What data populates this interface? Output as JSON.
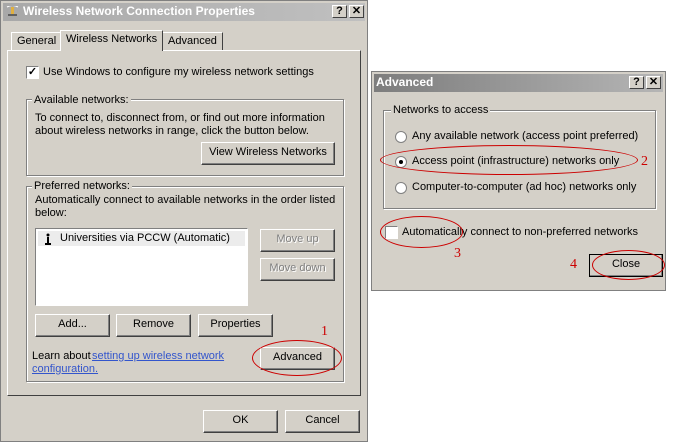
{
  "main_dialog": {
    "title": "Wireless Network Connection Properties",
    "help_button": "?",
    "close_button": "✕",
    "tabs": [
      {
        "label": "General"
      },
      {
        "label": "Wireless Networks"
      },
      {
        "label": "Advanced"
      }
    ],
    "use_windows_checkbox": {
      "label": "Use Windows to configure my wireless network settings",
      "checked": true
    },
    "available_networks": {
      "group_label": "Available networks:",
      "description_line1": "To connect to, disconnect from, or find out more information",
      "description_line2": "about wireless networks in range, click the button below.",
      "view_button": "View Wireless Networks"
    },
    "preferred_networks": {
      "group_label": "Preferred networks:",
      "description_line1": "Automatically connect to available networks in the order listed",
      "description_line2": "below:",
      "items": [
        {
          "label": "Universities via PCCW (Automatic)"
        }
      ],
      "move_up_button": "Move up",
      "move_down_button": "Move down",
      "add_button": "Add...",
      "remove_button": "Remove",
      "properties_button": "Properties",
      "learn_about_text": "Learn about",
      "learn_link_line1": "setting up wireless network",
      "learn_link_line2": "configuration.",
      "advanced_button": "Advanced"
    },
    "ok_button": "OK",
    "cancel_button": "Cancel"
  },
  "advanced_dialog": {
    "title": "Advanced",
    "help_button": "?",
    "close_button": "✕",
    "group_label": "Networks to access",
    "options": [
      {
        "label": "Any available network (access point preferred)",
        "selected": false
      },
      {
        "label": "Access point (infrastructure) networks only",
        "selected": true
      },
      {
        "label": "Computer-to-computer (ad hoc) networks only",
        "selected": false
      }
    ],
    "auto_connect_checkbox": {
      "label": "Automatically connect to non-preferred networks",
      "checked": false
    },
    "close_dialog_button": "Close"
  },
  "annotations": {
    "step1": "1",
    "step2": "2",
    "step3": "3",
    "step4": "4",
    "color": "#cc0000"
  }
}
